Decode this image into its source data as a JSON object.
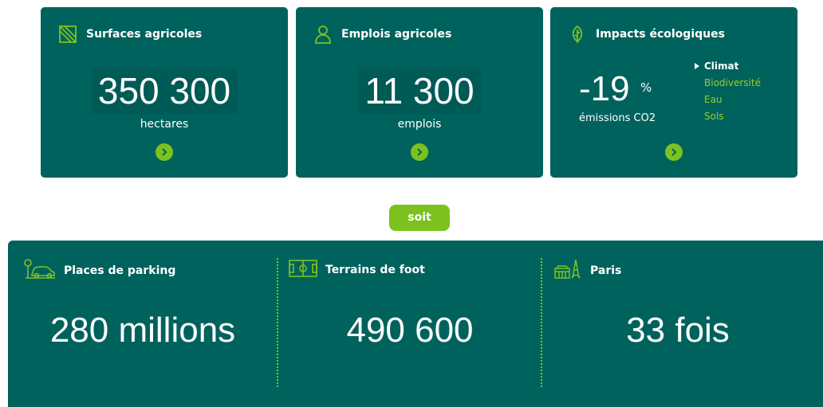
{
  "cards": [
    {
      "title": "Surfaces agricoles",
      "icon": "field-icon",
      "value": "350 300",
      "unit": "hectares"
    },
    {
      "title": "Emplois agricoles",
      "icon": "person-icon",
      "value": "11 300",
      "unit": "emplois"
    }
  ],
  "eco": {
    "title": "Impacts écologiques",
    "icon": "leaf-icon",
    "value": "-19",
    "percent": "%",
    "unit": "émissions CO2",
    "tabs": [
      "Climat",
      "Biodiversité",
      "Eau",
      "Sols"
    ],
    "active_tab": "Climat"
  },
  "soit_label": "soit",
  "equivalents": [
    {
      "title": "Places de parking",
      "icon": "parking-car-icon",
      "value": "280 millions"
    },
    {
      "title": "Terrains de foot",
      "icon": "football-field-icon",
      "value": "490 600"
    },
    {
      "title": "Paris",
      "icon": "paris-eiffel-icon",
      "value": "33 fois"
    }
  ],
  "colors": {
    "primary": "#00625d",
    "accent": "#7cc21f",
    "text": "#ffffff"
  }
}
